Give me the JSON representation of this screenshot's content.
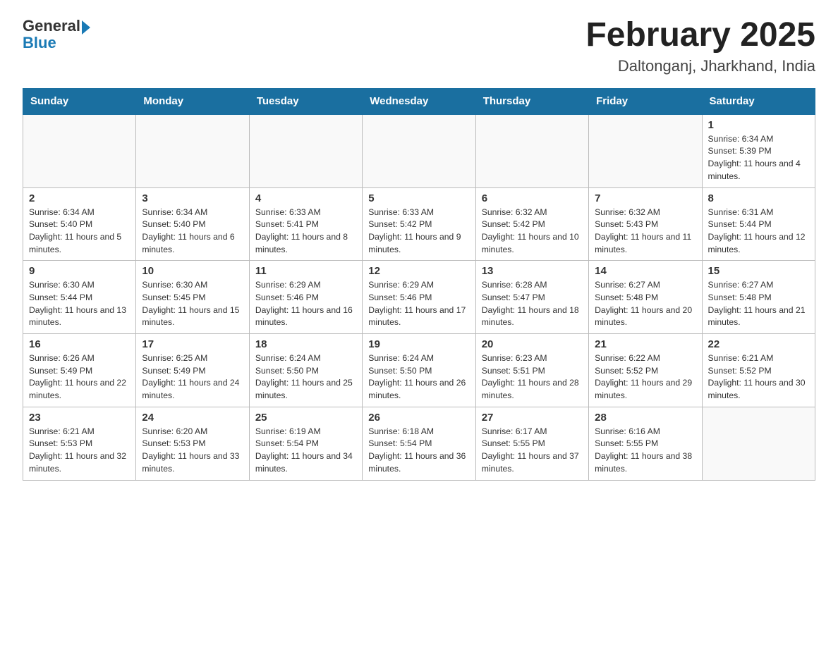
{
  "header": {
    "logo_general": "General",
    "logo_blue": "Blue",
    "title": "February 2025",
    "subtitle": "Daltonganj, Jharkhand, India"
  },
  "days_of_week": [
    "Sunday",
    "Monday",
    "Tuesday",
    "Wednesday",
    "Thursday",
    "Friday",
    "Saturday"
  ],
  "weeks": [
    [
      {
        "day": "",
        "info": ""
      },
      {
        "day": "",
        "info": ""
      },
      {
        "day": "",
        "info": ""
      },
      {
        "day": "",
        "info": ""
      },
      {
        "day": "",
        "info": ""
      },
      {
        "day": "",
        "info": ""
      },
      {
        "day": "1",
        "info": "Sunrise: 6:34 AM\nSunset: 5:39 PM\nDaylight: 11 hours and 4 minutes."
      }
    ],
    [
      {
        "day": "2",
        "info": "Sunrise: 6:34 AM\nSunset: 5:40 PM\nDaylight: 11 hours and 5 minutes."
      },
      {
        "day": "3",
        "info": "Sunrise: 6:34 AM\nSunset: 5:40 PM\nDaylight: 11 hours and 6 minutes."
      },
      {
        "day": "4",
        "info": "Sunrise: 6:33 AM\nSunset: 5:41 PM\nDaylight: 11 hours and 8 minutes."
      },
      {
        "day": "5",
        "info": "Sunrise: 6:33 AM\nSunset: 5:42 PM\nDaylight: 11 hours and 9 minutes."
      },
      {
        "day": "6",
        "info": "Sunrise: 6:32 AM\nSunset: 5:42 PM\nDaylight: 11 hours and 10 minutes."
      },
      {
        "day": "7",
        "info": "Sunrise: 6:32 AM\nSunset: 5:43 PM\nDaylight: 11 hours and 11 minutes."
      },
      {
        "day": "8",
        "info": "Sunrise: 6:31 AM\nSunset: 5:44 PM\nDaylight: 11 hours and 12 minutes."
      }
    ],
    [
      {
        "day": "9",
        "info": "Sunrise: 6:30 AM\nSunset: 5:44 PM\nDaylight: 11 hours and 13 minutes."
      },
      {
        "day": "10",
        "info": "Sunrise: 6:30 AM\nSunset: 5:45 PM\nDaylight: 11 hours and 15 minutes."
      },
      {
        "day": "11",
        "info": "Sunrise: 6:29 AM\nSunset: 5:46 PM\nDaylight: 11 hours and 16 minutes."
      },
      {
        "day": "12",
        "info": "Sunrise: 6:29 AM\nSunset: 5:46 PM\nDaylight: 11 hours and 17 minutes."
      },
      {
        "day": "13",
        "info": "Sunrise: 6:28 AM\nSunset: 5:47 PM\nDaylight: 11 hours and 18 minutes."
      },
      {
        "day": "14",
        "info": "Sunrise: 6:27 AM\nSunset: 5:48 PM\nDaylight: 11 hours and 20 minutes."
      },
      {
        "day": "15",
        "info": "Sunrise: 6:27 AM\nSunset: 5:48 PM\nDaylight: 11 hours and 21 minutes."
      }
    ],
    [
      {
        "day": "16",
        "info": "Sunrise: 6:26 AM\nSunset: 5:49 PM\nDaylight: 11 hours and 22 minutes."
      },
      {
        "day": "17",
        "info": "Sunrise: 6:25 AM\nSunset: 5:49 PM\nDaylight: 11 hours and 24 minutes."
      },
      {
        "day": "18",
        "info": "Sunrise: 6:24 AM\nSunset: 5:50 PM\nDaylight: 11 hours and 25 minutes."
      },
      {
        "day": "19",
        "info": "Sunrise: 6:24 AM\nSunset: 5:50 PM\nDaylight: 11 hours and 26 minutes."
      },
      {
        "day": "20",
        "info": "Sunrise: 6:23 AM\nSunset: 5:51 PM\nDaylight: 11 hours and 28 minutes."
      },
      {
        "day": "21",
        "info": "Sunrise: 6:22 AM\nSunset: 5:52 PM\nDaylight: 11 hours and 29 minutes."
      },
      {
        "day": "22",
        "info": "Sunrise: 6:21 AM\nSunset: 5:52 PM\nDaylight: 11 hours and 30 minutes."
      }
    ],
    [
      {
        "day": "23",
        "info": "Sunrise: 6:21 AM\nSunset: 5:53 PM\nDaylight: 11 hours and 32 minutes."
      },
      {
        "day": "24",
        "info": "Sunrise: 6:20 AM\nSunset: 5:53 PM\nDaylight: 11 hours and 33 minutes."
      },
      {
        "day": "25",
        "info": "Sunrise: 6:19 AM\nSunset: 5:54 PM\nDaylight: 11 hours and 34 minutes."
      },
      {
        "day": "26",
        "info": "Sunrise: 6:18 AM\nSunset: 5:54 PM\nDaylight: 11 hours and 36 minutes."
      },
      {
        "day": "27",
        "info": "Sunrise: 6:17 AM\nSunset: 5:55 PM\nDaylight: 11 hours and 37 minutes."
      },
      {
        "day": "28",
        "info": "Sunrise: 6:16 AM\nSunset: 5:55 PM\nDaylight: 11 hours and 38 minutes."
      },
      {
        "day": "",
        "info": ""
      }
    ]
  ]
}
